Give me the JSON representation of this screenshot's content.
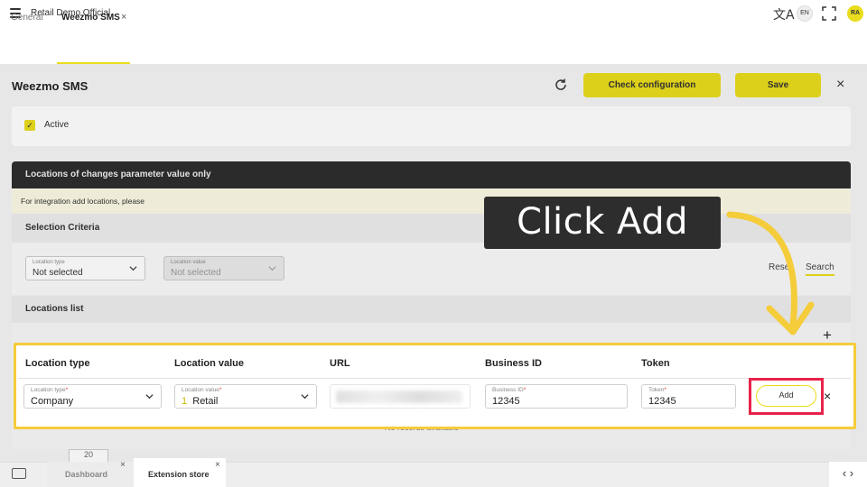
{
  "app": {
    "title": "Retail Demo Official",
    "lang": "EN",
    "avatar": "RA"
  },
  "tabs": {
    "general": "General",
    "active": "Weezmo SMS",
    "close": "×"
  },
  "page": {
    "title": "Weezmo SMS",
    "check_label": "Check configuration",
    "save_label": "Save",
    "close": "×",
    "active_label": "Active",
    "active_check": "✓"
  },
  "locations": {
    "header": "Locations of changes parameter value only",
    "info": "For integration add locations, please",
    "selection_title": "Selection Criteria",
    "filter_type_label": "Location type",
    "filter_type_value": "Not selected",
    "filter_value_label": "Location value",
    "filter_value_value": "Not selected",
    "reset": "Reset",
    "search": "Search",
    "list_title": "Locations list",
    "add_icon": "+",
    "no_records": "No records available",
    "page_size": "20"
  },
  "row": {
    "columns": [
      "Location type",
      "Location value",
      "URL",
      "Business ID",
      "Token"
    ],
    "loc_type_label": "Location type",
    "loc_type_value": "Company",
    "loc_value_label": "Location value",
    "loc_value_index": "1",
    "loc_value_value": "Retail",
    "business_label": "Business ID",
    "business_value": "12345",
    "token_label": "Token",
    "token_value": "12345",
    "required_mark": "*",
    "add_label": "Add",
    "close": "×"
  },
  "callout": {
    "text": "Click Add"
  },
  "bottom": {
    "tab1": "Dashboard",
    "tab2": "Extension store",
    "close": "×",
    "nav": "‹ ›"
  },
  "colors": {
    "accent": "#e9dc1c",
    "highlight": "#f5cc3a",
    "focus_red": "#e8234a",
    "callout_bg": "#2d2d2d"
  }
}
